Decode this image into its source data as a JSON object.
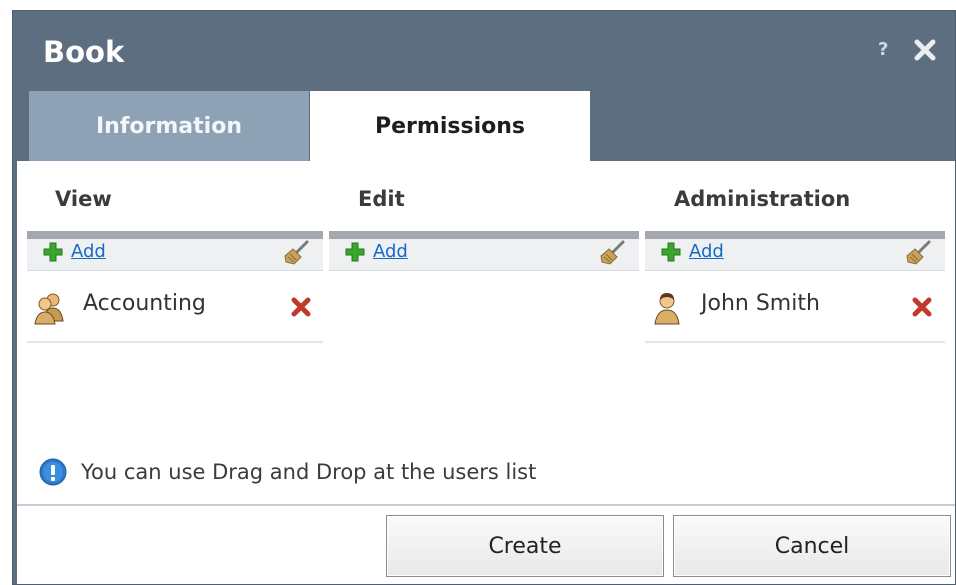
{
  "dialog": {
    "title": "Book",
    "help_label": "?"
  },
  "tabs": [
    {
      "label": "Information",
      "active": false
    },
    {
      "label": "Permissions",
      "active": true
    }
  ],
  "columns": [
    {
      "title": "View",
      "add_label": "Add",
      "entries": [
        {
          "name": "Accounting",
          "type": "group-icon"
        }
      ]
    },
    {
      "title": "Edit",
      "add_label": "Add",
      "entries": []
    },
    {
      "title": "Administration",
      "add_label": "Add",
      "entries": [
        {
          "name": "John Smith",
          "type": "user-icon"
        }
      ]
    }
  ],
  "info": {
    "text": "You can use Drag and Drop at the users list"
  },
  "buttons": {
    "create": "Create",
    "cancel": "Cancel"
  },
  "colors": {
    "header": "#5d6e80",
    "inactive_tab": "#8ea2b6",
    "link": "#1769c8",
    "remove": "#c0392b",
    "add": "#3aa62e"
  }
}
